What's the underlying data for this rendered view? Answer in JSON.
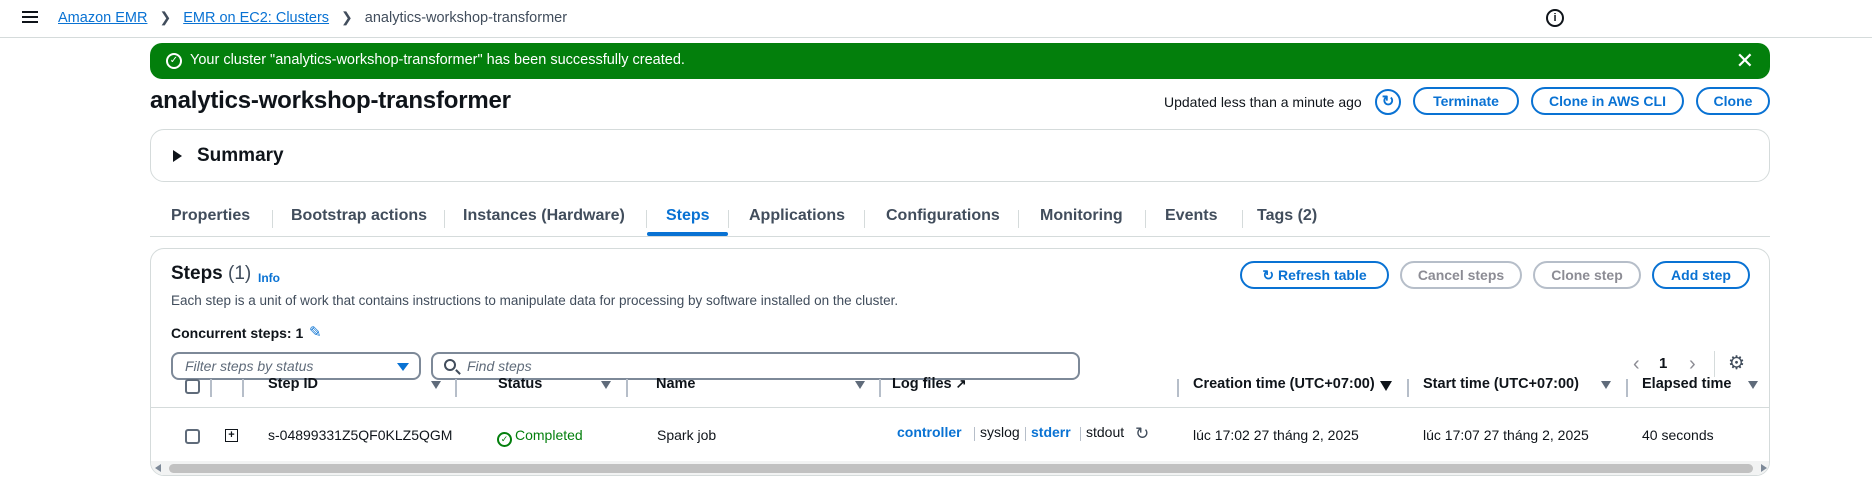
{
  "breadcrumbs": [
    {
      "label": "Amazon EMR"
    },
    {
      "label": "EMR on EC2: Clusters"
    },
    {
      "label": "analytics-workshop-transformer"
    }
  ],
  "flash": {
    "message": "Your cluster \"analytics-workshop-transformer\" has been successfully created.",
    "type": "success"
  },
  "header": {
    "title": "analytics-workshop-transformer",
    "updated": "Updated less than a minute ago",
    "buttons": {
      "terminate": "Terminate",
      "clone_cli": "Clone in AWS CLI",
      "clone": "Clone"
    }
  },
  "summary": {
    "label": "Summary"
  },
  "tabs": [
    {
      "label": "Properties"
    },
    {
      "label": "Bootstrap actions"
    },
    {
      "label": "Instances (Hardware)"
    },
    {
      "label": "Steps",
      "active": true
    },
    {
      "label": "Applications"
    },
    {
      "label": "Configurations"
    },
    {
      "label": "Monitoring"
    },
    {
      "label": "Events"
    },
    {
      "label": "Tags (2)"
    }
  ],
  "steps": {
    "title": "Steps",
    "count": "(1)",
    "info": "Info",
    "description": "Each step is a unit of work that contains instructions to manipulate data for processing by software installed on the cluster.",
    "concurrent": "Concurrent steps: 1",
    "buttons": {
      "refresh": "Refresh table",
      "cancel": "Cancel steps",
      "clone": "Clone step",
      "add": "Add step"
    },
    "filter_placeholder": "Filter steps by status",
    "search_placeholder": "Find steps",
    "page": "1",
    "columns": {
      "step_id": "Step ID",
      "status": "Status",
      "name": "Name",
      "log_files": "Log files",
      "creation": "Creation time (UTC+07:00)",
      "start": "Start time (UTC+07:00)",
      "elapsed": "Elapsed time"
    },
    "rows": [
      {
        "step_id": "s-04899331Z5QF0KLZ5QGM",
        "status": "Completed",
        "name": "Spark job",
        "logs": [
          "controller",
          "syslog",
          "stderr",
          "stdout"
        ],
        "creation": "lúc 17:02 27 tháng 2, 2025",
        "start": "lúc 17:07 27 tháng 2, 2025",
        "elapsed": "40 seconds"
      }
    ]
  },
  "colors": {
    "accent": "#0972d3",
    "success": "#037f0c",
    "text": "#0f141a",
    "border": "#d5dbdb"
  },
  "icons": [
    "menu-icon",
    "info-icon",
    "success-icon",
    "close-icon",
    "refresh-icon",
    "caret-right-icon",
    "edit-icon",
    "search-icon",
    "external-link-icon",
    "settings-icon"
  ]
}
